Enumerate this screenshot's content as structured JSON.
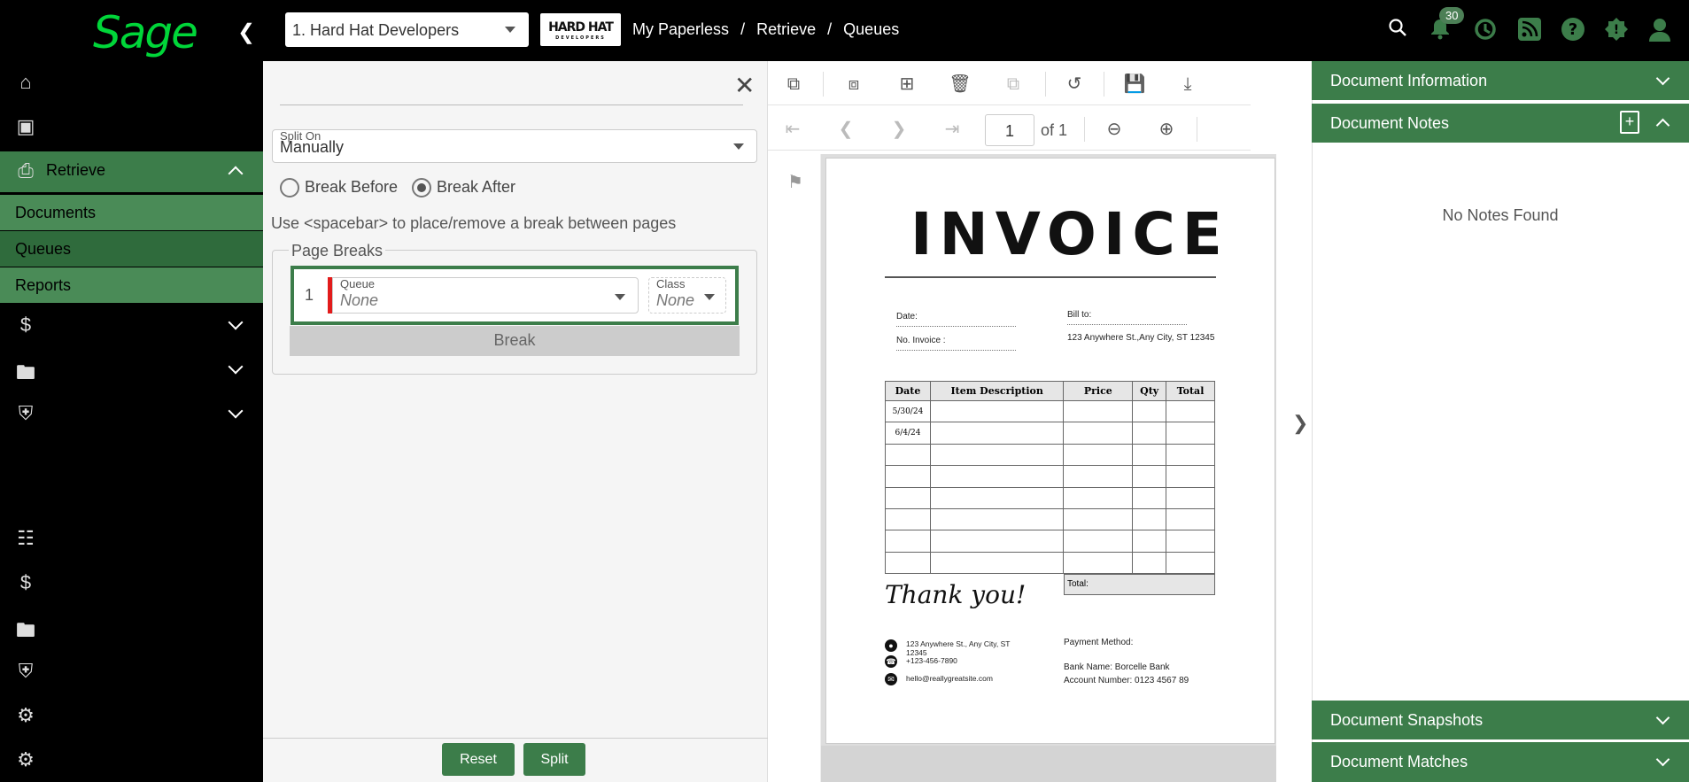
{
  "topbar": {
    "logo": "Sage",
    "company": "1. Hard Hat Developers",
    "brand": "HARD HAT",
    "brand_sub": "DEVELOPERS",
    "breadcrumb": [
      "My Paperless",
      "/",
      "Retrieve",
      "/",
      "Queues"
    ],
    "notification_count": "30"
  },
  "sidebar": {
    "items": [
      {
        "label": "My Paperless",
        "icon": "home-icon"
      },
      {
        "label": "Capture",
        "icon": "capture-icon"
      },
      {
        "label": "Retrieve",
        "icon": "retrieve-icon"
      },
      {
        "label": "APFlow™",
        "icon": "dollar-doc-icon"
      },
      {
        "label": "DocRoute™",
        "icon": "folder-route-icon"
      },
      {
        "label": "ClearToPay™",
        "icon": "shield-lock-icon"
      }
    ],
    "subitems": [
      "Documents",
      "Queues",
      "Reports"
    ],
    "settings": [
      {
        "label": "Address Book Settings",
        "icon": "address-book-icon"
      },
      {
        "label": "APFlow™ Settings",
        "icon": "dollar-doc-icon"
      },
      {
        "label": "DocRoute™ Settings",
        "icon": "folder-route-icon"
      },
      {
        "label": "ClearToPay™ Settings",
        "icon": "shield-lock-icon"
      },
      {
        "label": "Vault Settings",
        "icon": "gear-icon"
      },
      {
        "label": "Global Settings",
        "icon": "gear-icon"
      }
    ]
  },
  "split": {
    "split_on_label": "Split On",
    "split_on_value": "Manually",
    "break_before": "Break Before",
    "break_after": "Break After",
    "selected": "Break After",
    "hint": "Use <spacebar> to place/remove a break between pages",
    "page_breaks_legend": "Page Breaks",
    "row_number": "1",
    "queue_label": "Queue",
    "queue_value": "None",
    "class_label": "Class",
    "class_value": "None",
    "break_button": "Break",
    "reset_button": "Reset",
    "split_button": "Split"
  },
  "viewer": {
    "page_number": "1",
    "page_total": "of 1"
  },
  "invoice": {
    "title": "INVOICE",
    "date_label": "Date:",
    "no_invoice_label": "No. Invoice :",
    "bill_to_label": "Bill to:",
    "bill_to_address": "123 Anywhere St.,Any City, ST 12345",
    "columns": [
      "Date",
      "Item Description",
      "Price",
      "Qty",
      "Total"
    ],
    "rows": [
      [
        "5/30/24",
        "",
        "",
        "",
        ""
      ],
      [
        "6/4/24",
        "",
        "",
        "",
        ""
      ],
      [
        "",
        "",
        "",
        "",
        ""
      ],
      [
        "",
        "",
        "",
        "",
        ""
      ],
      [
        "",
        "",
        "",
        "",
        ""
      ],
      [
        "",
        "",
        "",
        "",
        ""
      ],
      [
        "",
        "",
        "",
        "",
        ""
      ],
      [
        "",
        "",
        "",
        "",
        ""
      ]
    ],
    "total_label": "Total:",
    "thanks": "Thank you!",
    "address": "123 Anywhere St., Any City, ST 12345",
    "phone": "+123-456-7890",
    "email": "hello@reallygreatsite.com",
    "payment_method": "Payment Method:",
    "bank_name": "Bank Name: Borcelle Bank",
    "account_number": "Account Number: 0123 4567 89"
  },
  "right_panel": {
    "document_information": "Document Information",
    "document_notes": "Document Notes",
    "no_notes": "No Notes Found",
    "document_snapshots": "Document Snapshots",
    "document_matches": "Document Matches"
  },
  "colors": {
    "accent": "#3c7d4a",
    "logo_green": "#00d639",
    "queue_marker": "#e21b1b"
  }
}
